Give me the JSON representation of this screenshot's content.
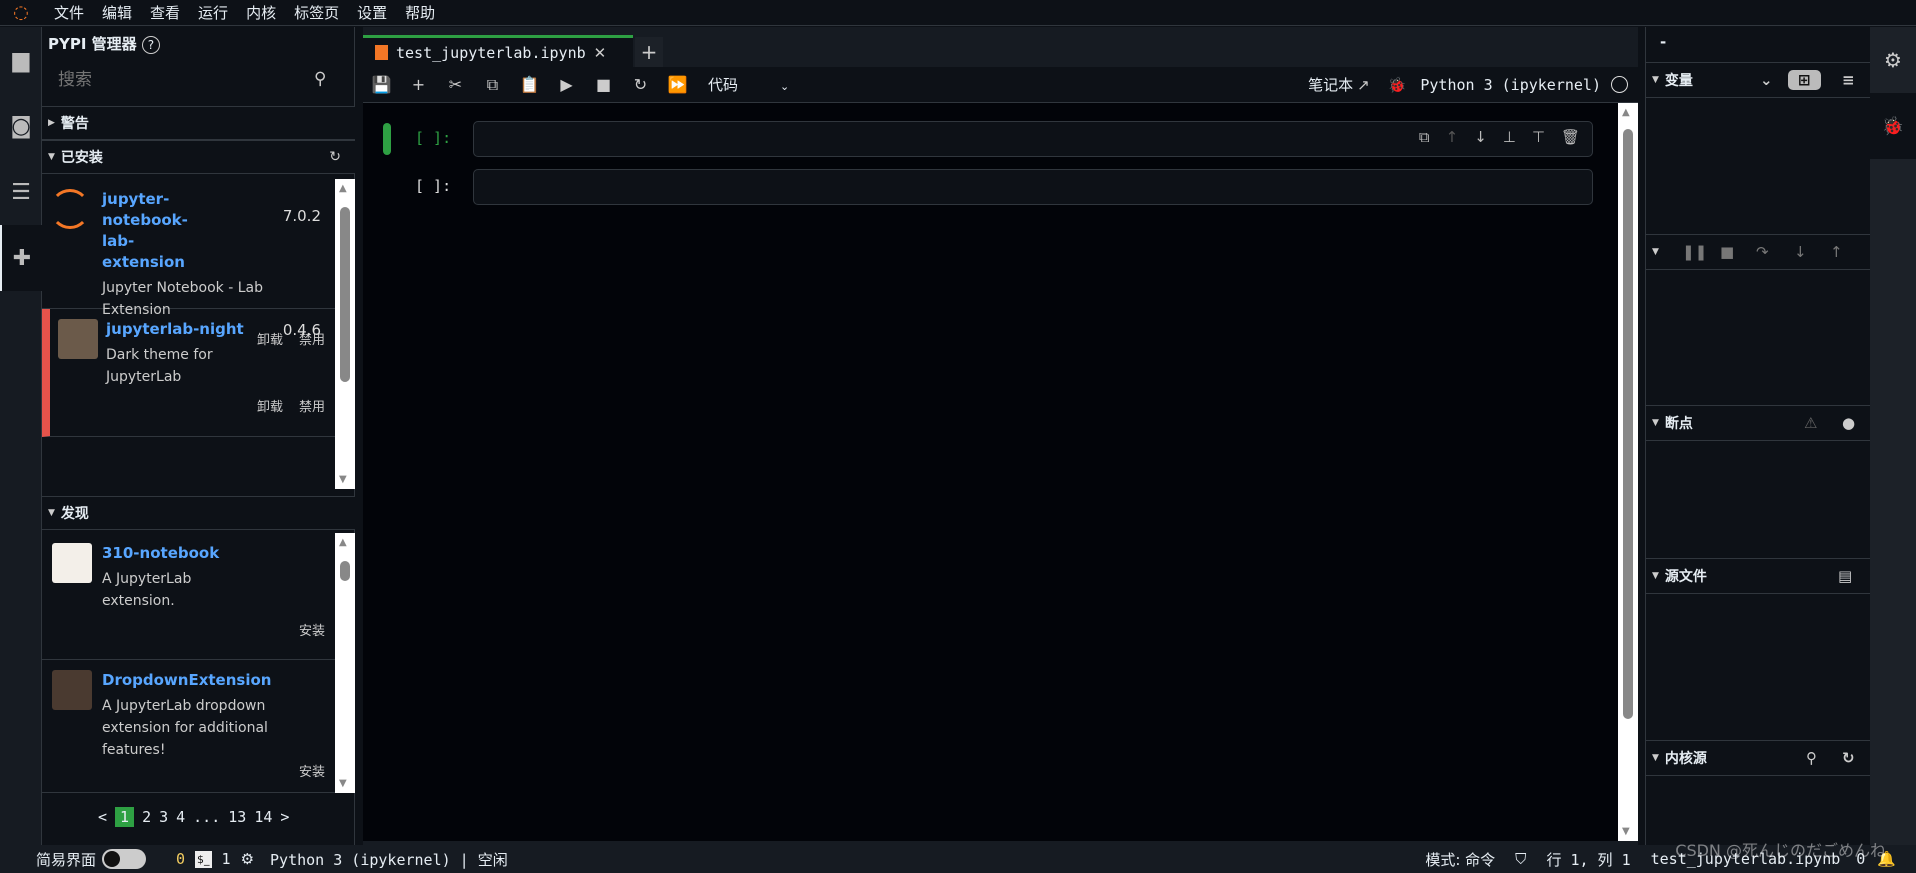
{
  "menu": [
    "文件",
    "编辑",
    "查看",
    "运行",
    "内核",
    "标签页",
    "设置",
    "帮助"
  ],
  "left_panel": {
    "title": "PYPI 管理器",
    "help": "?",
    "search_placeholder": "搜索",
    "warnings_label": "警告",
    "installed_label": "已安装",
    "discover_label": "发现",
    "installed": [
      {
        "name": "jupyter-notebook-lab-extension",
        "version": "7.0.2",
        "desc": "Jupyter Notebook - Lab Extension",
        "actions": [
          "卸载",
          "禁用"
        ]
      },
      {
        "name": "jupyterlab-night",
        "version": "0.4.6",
        "desc": "Dark theme for JupyterLab",
        "actions": [
          "卸载",
          "禁用"
        ]
      }
    ],
    "discover": [
      {
        "name": "310-notebook",
        "desc": "A JupyterLab extension.",
        "action": "安装"
      },
      {
        "name": "DropdownExtension",
        "desc": "A JupyterLab dropdown extension for additional features!",
        "action": "安装"
      }
    ],
    "pagination": {
      "prev": "<",
      "pages": [
        "1",
        "2",
        "3",
        "4",
        "...",
        "13",
        "14"
      ],
      "next": ">",
      "current": "1"
    }
  },
  "notebook": {
    "tab_title": "test_jupyterlab.ipynb",
    "cell_type": "代码",
    "notebook_label": "笔记本",
    "kernel": "Python 3 (ipykernel)",
    "cells": [
      {
        "prompt": "[ ]:"
      },
      {
        "prompt": "[ ]:"
      }
    ]
  },
  "debugger": {
    "header": "-",
    "variables": "变量",
    "breakpoints": "断点",
    "sources": "源文件",
    "kernel_sources": "内核源"
  },
  "status": {
    "simple_mode": "简易界面",
    "terminals": "0",
    "kernels": "1",
    "kernel_status": "Python 3 (ipykernel) | 空闲",
    "mode": "模式: 命令",
    "position": "行 1, 列 1",
    "file": "test_jupyterlab.ipynb",
    "notifications": "0",
    "watermark": "CSDN @死んじのだごめんね"
  },
  "colors": {
    "accent": "#2ea043",
    "link": "#58a6ff",
    "error": "#e5534b",
    "logo": "#f37726"
  }
}
